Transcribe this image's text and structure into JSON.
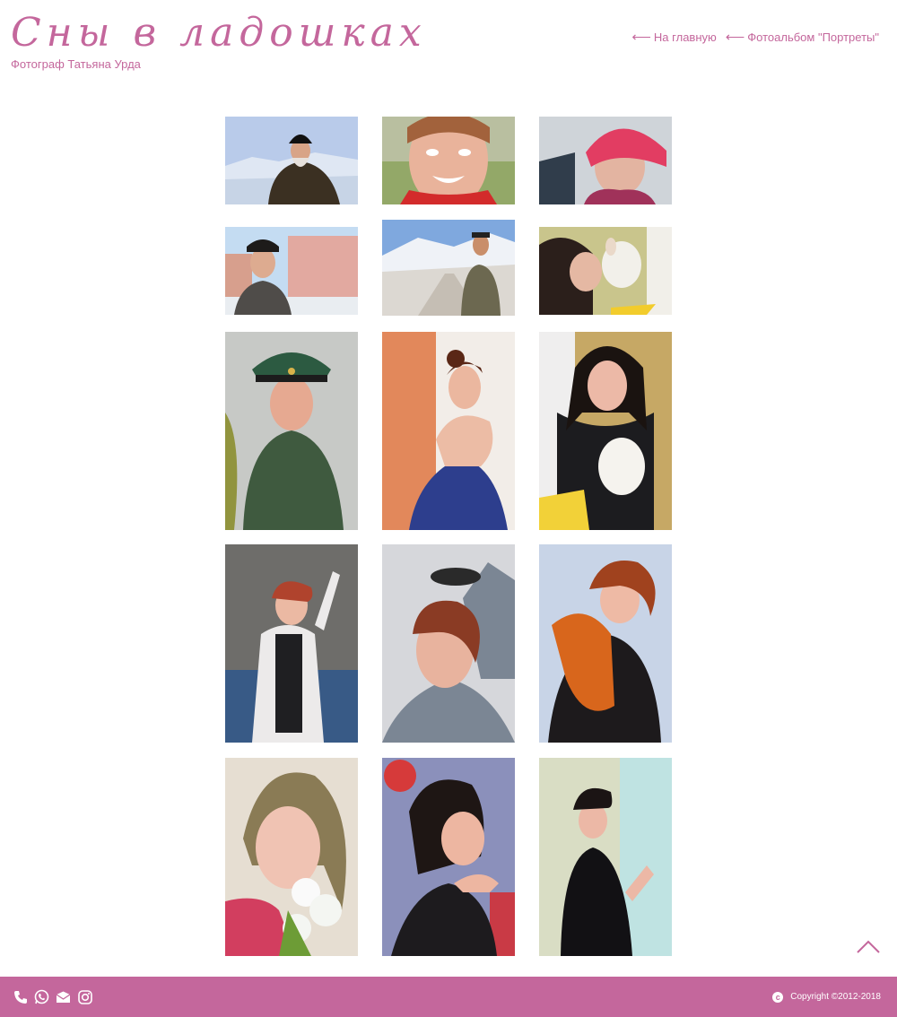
{
  "header": {
    "site_title": "Сны в ладошках",
    "site_subtitle": "Фотограф Татьяна Урда",
    "nav": [
      {
        "arrow": "⟵",
        "label": "На главную"
      },
      {
        "arrow": "⟵",
        "label": "Фотоальбом \"Портреты\""
      }
    ]
  },
  "gallery": {
    "photos": [
      {
        "subject": "priest-in-snowy-mountains"
      },
      {
        "subject": "smiling-woman-closeup"
      },
      {
        "subject": "woman-in-red-knit-hat"
      },
      {
        "subject": "man-in-cap-near-buildings"
      },
      {
        "subject": "man-on-snowy-road"
      },
      {
        "subject": "woman-kissing-dog"
      },
      {
        "subject": "officer-in-green-uniform"
      },
      {
        "subject": "woman-in-blue-dress"
      },
      {
        "subject": "woman-holding-dog"
      },
      {
        "subject": "woman-waving-in-white-jacket"
      },
      {
        "subject": "woman-with-sunglasses"
      },
      {
        "subject": "woman-with-fox"
      },
      {
        "subject": "woman-with-flowers"
      },
      {
        "subject": "woman-resting-chin"
      },
      {
        "subject": "woman-by-window"
      }
    ]
  },
  "footer": {
    "copyright": "Copyright ©2012-2018",
    "icons": [
      "phone-icon",
      "whatsapp-icon",
      "email-icon",
      "instagram-icon"
    ]
  },
  "colors": {
    "accent": "#c4679c",
    "background": "#ffffff"
  }
}
